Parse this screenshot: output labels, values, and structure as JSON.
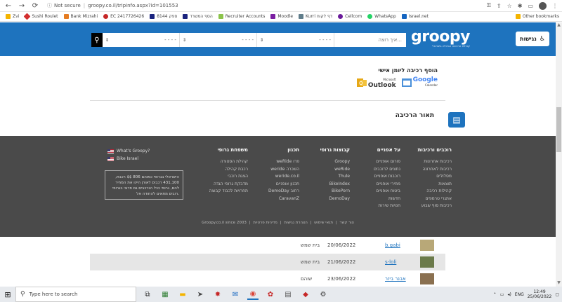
{
  "browser": {
    "security": "Not secure",
    "url": "groopy.co.il/tripinfo.aspx?id=101553",
    "bookmarks": [
      "Zvi",
      "Sushi Roulet",
      "Bank Mizrahi",
      "EC 2417726426",
      "8144 ספק",
      "הסף המשרד",
      "Recruiter Accounts",
      "Moodle",
      "Kurri דף לקוח",
      "Cellcom",
      "WhatsApp",
      "Israel.net"
    ],
    "other_bookmarks": "Other bookmarks"
  },
  "header": {
    "search_placeholder": "איך רוצה...",
    "select1": "- - - -",
    "select2": "- - - -",
    "select3": "- - - -",
    "logo_main": "groopy",
    "logo_sub": "קהילת הרכיבה הגדולה בישראל",
    "access_label": "נגישות"
  },
  "content": {
    "add_diary_title": "הוסף רכיבה ליומן אישי",
    "outlook_label": "Outlook",
    "outlook_small": "Microsoft",
    "google_label": "Google",
    "google_small": "Calendar",
    "desc_title": "תאור הרכיבה"
  },
  "footer": {
    "columns": [
      {
        "heading": "רוכבים ורכיבות",
        "items": [
          "רכיבות אחרונות",
          "רכיבות לאחרונה",
          "מסלולים",
          "תוצאות",
          "קהילות רכיבה",
          "אתגרי טרמפים",
          "רכיבות סוף שבוע"
        ]
      },
      {
        "heading": "על אפניים",
        "items": [
          "פורום אופניים",
          "נתונים לרוכבים",
          "רוכבות אופניים",
          "מחירי אופניים",
          "ביטוח אופניים",
          "חדשות",
          "חנויות שירות"
        ]
      },
      {
        "heading": "קבוצות גרופי",
        "items": [
          "Groopy",
          "weRide",
          "Thule",
          "BikeIndex",
          "BikePorn",
          "DemoDay"
        ]
      },
      {
        "heading": "תכנון",
        "items": [
          "weRide פרו",
          "weride השכרה",
          "weride.co.il",
          "תכנון אופניים",
          "DemoDay רחוב",
          "CaravanZ"
        ]
      },
      {
        "heading": "משפחת גרופי",
        "items": [
          "קהילת הסטורה",
          "רכבת קהילה",
          "הצגת רוכבי",
          "מדבקת גרופי הגדה",
          "תחרויות לכבוד קבוצה"
        ]
      }
    ],
    "flags": [
      "What's Groopy?",
      "Bike Israel"
    ],
    "box_text": "הישראלי בגרופי כמוהם 806 $$ רכבת, 431,100 רכבים לאורן היינו את המחיר להם, גרופי ככל הנרכבים גם פרוגי בגרופי רובים מתאים להחודה אל.",
    "bottom_links": [
      "Groopy.co.il since 2003",
      "צור קשר",
      "תנאי שימוש",
      "הצהרת נגישות",
      "מדיניות פרטיות"
    ]
  },
  "rows": [
    {
      "user": "b.gabi",
      "date": "20/06/2022",
      "place": "בית שמש"
    },
    {
      "user": "s-loli",
      "date": "21/06/2022",
      "place": "בית שמש"
    },
    {
      "user": "אבנר ביזר",
      "date": "23/06/2022",
      "place": "שוהם"
    }
  ],
  "taskbar": {
    "search_placeholder": "Type here to search",
    "lang": "ENG",
    "time": "12:49",
    "date": "25/06/2022"
  },
  "colors": {
    "brand": "#1e73be",
    "footer": "#4a4a4a"
  }
}
